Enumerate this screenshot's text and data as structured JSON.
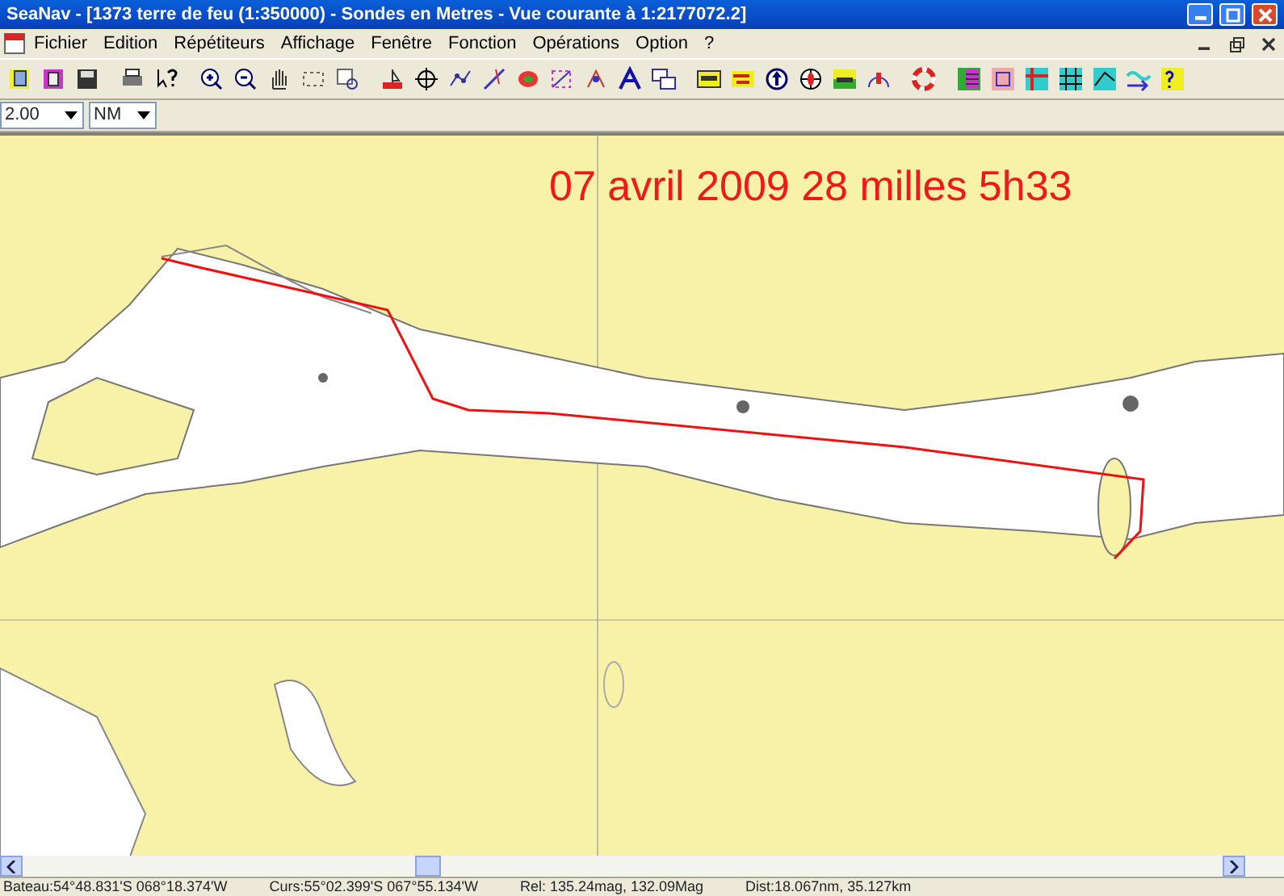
{
  "window": {
    "title": "SeaNav - [1373 terre de feu (1:350000) - Sondes en Metres - Vue courante à 1:2177072.2]"
  },
  "menu": [
    "Fichier",
    "Edition",
    "Répétiteurs",
    "Affichage",
    "Fenêtre",
    "Fonction",
    "Opérations",
    "Option",
    "?"
  ],
  "selectors": [
    {
      "value": "2.00"
    },
    {
      "value": "NM"
    }
  ],
  "chart": {
    "annotation": "07 avril 2009 28 milles 5h33"
  },
  "status_bar": [
    {
      "text": "Bateau:54°48.831'S 068°18.374'W"
    },
    {
      "text": "Curs:55°02.399'S 067°55.134'W"
    },
    {
      "text": "Rel: 135.24mag, 132.09Mag"
    },
    {
      "text": "Dist:18.067nm, 35.127km"
    }
  ]
}
